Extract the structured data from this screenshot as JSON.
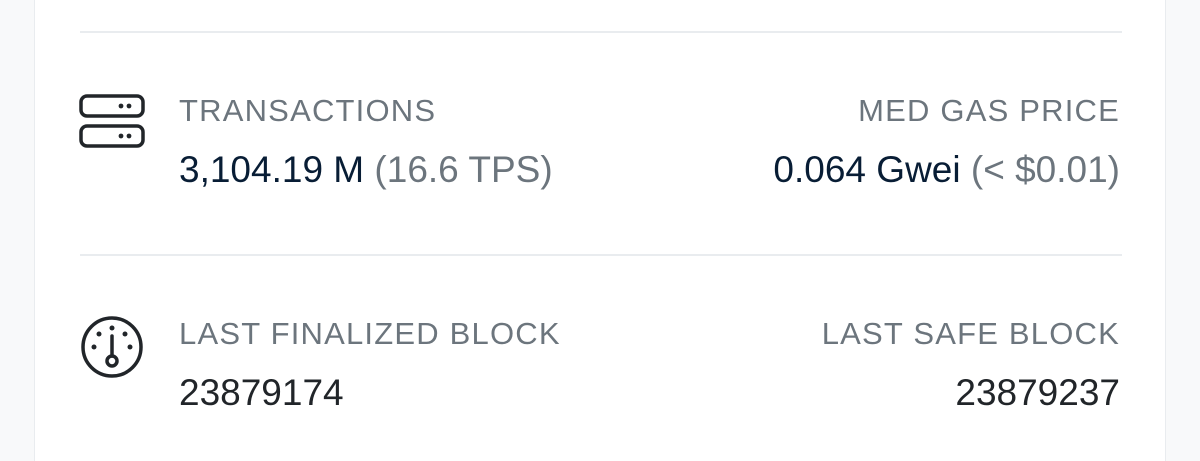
{
  "transactions": {
    "label": "TRANSACTIONS",
    "value": "3,104.19 M",
    "sub": "(16.6 TPS)"
  },
  "gas": {
    "label": "MED GAS PRICE",
    "value": "0.064 Gwei",
    "sub": "(< $0.01)"
  },
  "finalized": {
    "label": "LAST FINALIZED BLOCK",
    "value": "23879174"
  },
  "safe": {
    "label": "LAST SAFE BLOCK",
    "value": "23879237"
  },
  "icons": {
    "transactions": "server-icon",
    "finalized": "gauge-icon"
  },
  "colors": {
    "label": "#6c757d",
    "value": "#081d35",
    "block_value": "#212529",
    "divider": "#e9ecef"
  }
}
